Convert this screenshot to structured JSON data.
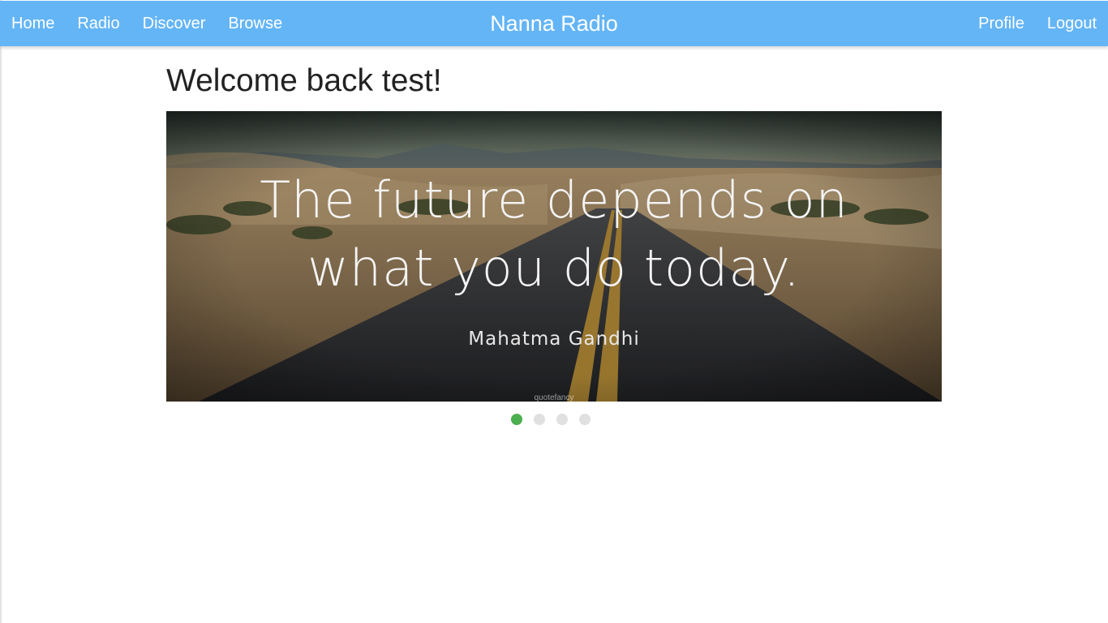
{
  "nav": {
    "left_links": [
      "Home",
      "Radio",
      "Discover",
      "Browse"
    ],
    "brand": "Nanna Radio",
    "right_links": [
      "Profile",
      "Logout"
    ]
  },
  "main": {
    "welcome": "Welcome back test!"
  },
  "carousel": {
    "slide": {
      "quote_line1": "The future depends on",
      "quote_line2": "what you do today.",
      "author": "Mahatma Gandhi",
      "watermark": "quotefancy"
    },
    "indicator_count": 4,
    "active_index": 0
  },
  "colors": {
    "navbar": "#64b5f6",
    "indicator_active": "#4caf50",
    "indicator_inactive": "#e0e0e0"
  }
}
